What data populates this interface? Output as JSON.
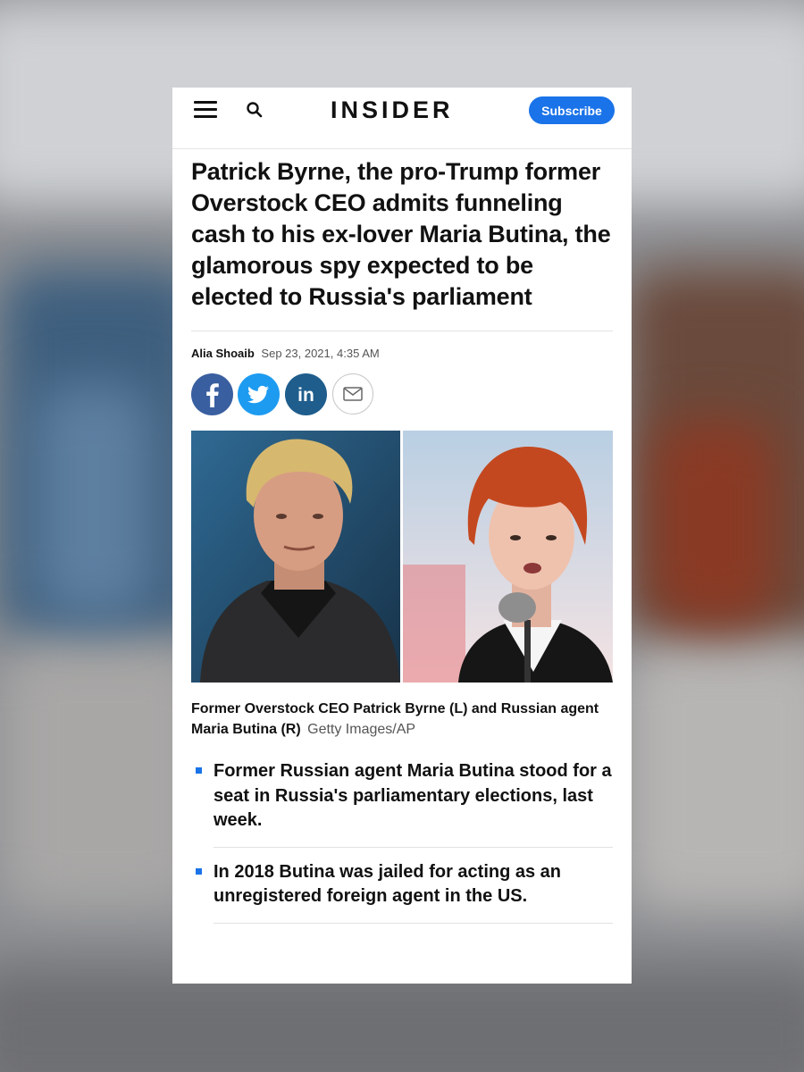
{
  "header": {
    "logo": "INSIDER",
    "subscribe_label": "Subscribe",
    "menu_icon": "hamburger-menu-icon",
    "search_icon": "search-icon"
  },
  "article": {
    "headline": "Patrick Byrne, the pro-Trump former Overstock CEO admits funneling cash to his ex-lover Maria Butina, the glamorous spy expected to be elected to Russia's parliament",
    "author": "Alia Shoaib",
    "date": "Sep 23, 2021, 4:35 AM",
    "share": [
      {
        "network": "facebook",
        "icon": "facebook-icon",
        "color": "#3a5fa0"
      },
      {
        "network": "twitter",
        "icon": "twitter-icon",
        "color": "#1d9bf0"
      },
      {
        "network": "linkedin",
        "icon": "linkedin-icon",
        "color": "#1e5d8c"
      },
      {
        "network": "email",
        "icon": "email-icon",
        "color": "#ffffff"
      }
    ],
    "caption": "Former Overstock CEO Patrick Byrne (L) and Russian agent Maria Butina (R)",
    "photo_credit": "Getty Images/AP",
    "bullets": [
      "Former Russian agent Maria Butina stood for a seat in Russia's parliamentary elections, last week.",
      "In 2018 Butina was jailed for acting as an unregistered foreign agent in the US."
    ]
  },
  "colors": {
    "accent": "#1a73e8",
    "text": "#111111",
    "muted": "#555555"
  }
}
